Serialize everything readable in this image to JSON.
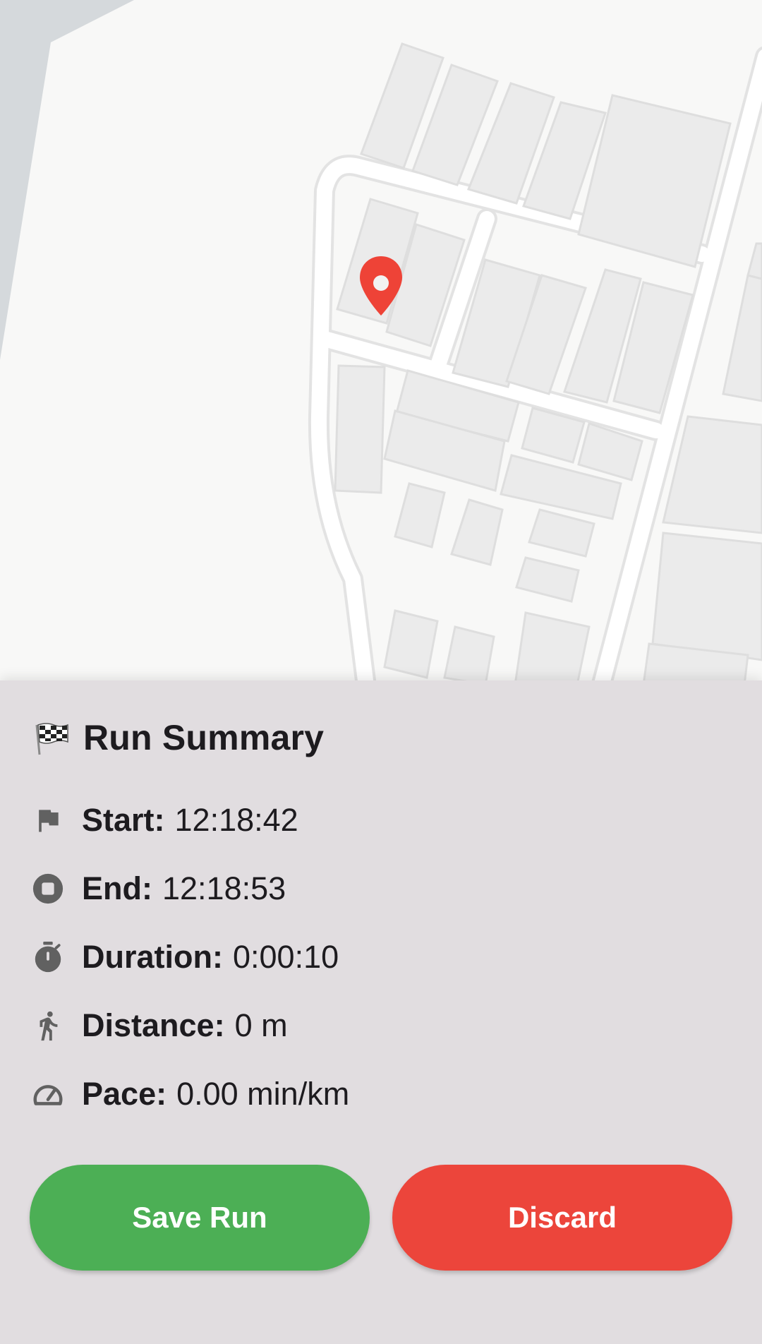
{
  "colors": {
    "map_background": "#f8f8f7",
    "water": "#d5d9dc",
    "building": "#ececec",
    "road": "#ffffff",
    "road_outline": "#e3e3e3",
    "marker": "#ee4337",
    "sheet_background": "#e1dde0",
    "save_button": "#4caf55",
    "discard_button": "#ec453b",
    "icon": "#616161"
  },
  "map": {
    "marker_icon": "location-pin-icon"
  },
  "summary": {
    "title_icon": "checkered-flag-icon",
    "title": "Run Summary",
    "stats": [
      {
        "icon": "flag-icon",
        "label": "Start:",
        "value": "12:18:42"
      },
      {
        "icon": "stop-circle-icon",
        "label": "End:",
        "value": "12:18:53"
      },
      {
        "icon": "stopwatch-icon",
        "label": "Duration:",
        "value": "0:00:10"
      },
      {
        "icon": "walking-person-icon",
        "label": "Distance:",
        "value": "0 m"
      },
      {
        "icon": "speedometer-icon",
        "label": "Pace:",
        "value": "0.00 min/km"
      }
    ]
  },
  "actions": {
    "save_label": "Save Run",
    "discard_label": "Discard"
  }
}
